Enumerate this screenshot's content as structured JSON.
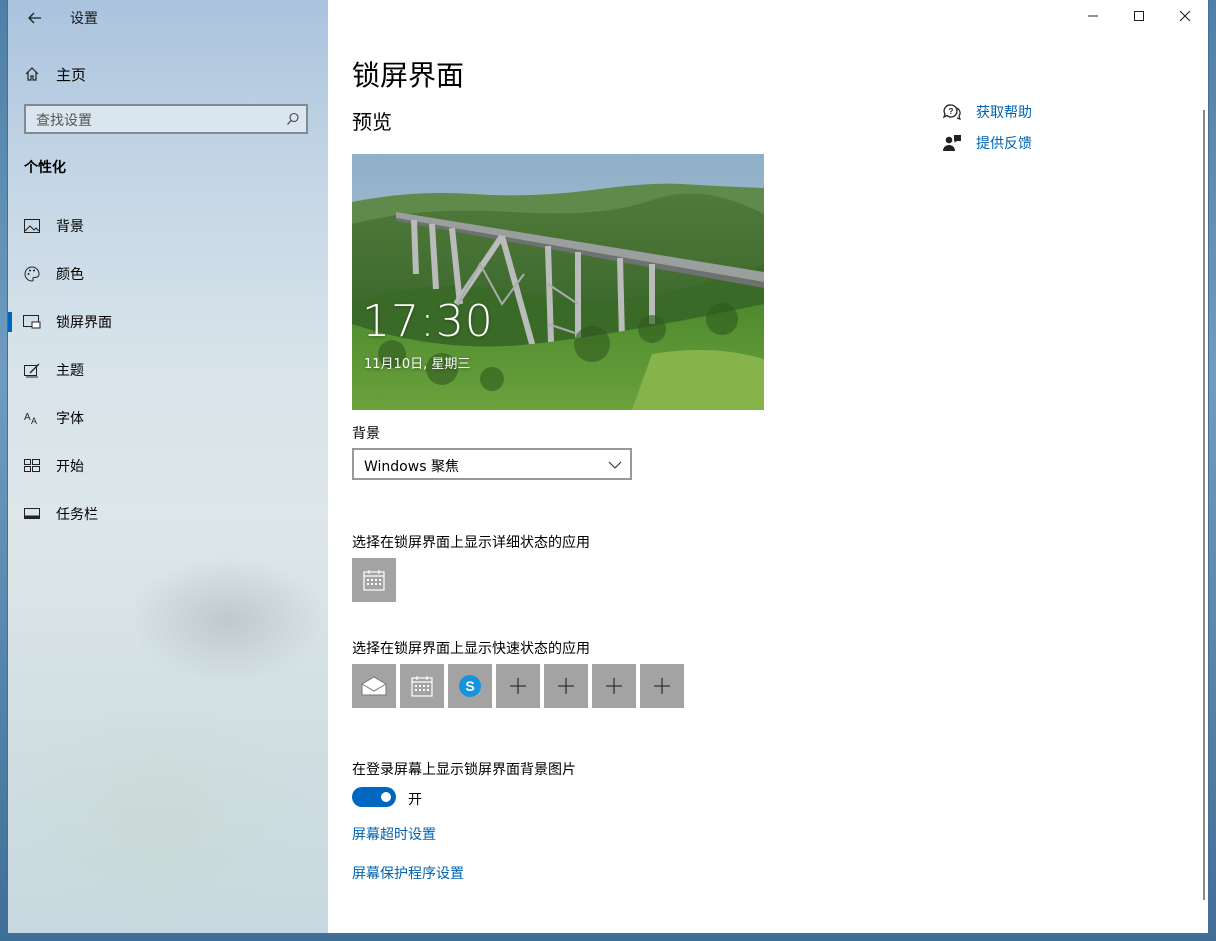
{
  "window": {
    "app_title": "设置",
    "controls": {
      "minimize": "minimize-icon",
      "maximize": "maximize-icon",
      "close": "close-icon"
    }
  },
  "sidebar": {
    "home_label": "主页",
    "search_placeholder": "查找设置",
    "section_title": "个性化",
    "items": [
      {
        "label": "背景",
        "icon": "picture-icon"
      },
      {
        "label": "颜色",
        "icon": "palette-icon"
      },
      {
        "label": "锁屏界面",
        "icon": "lock-screen-icon",
        "active": true
      },
      {
        "label": "主题",
        "icon": "theme-icon"
      },
      {
        "label": "字体",
        "icon": "font-icon"
      },
      {
        "label": "开始",
        "icon": "start-icon"
      },
      {
        "label": "任务栏",
        "icon": "taskbar-icon"
      }
    ]
  },
  "main": {
    "page_title": "锁屏界面",
    "preview_heading": "预览",
    "preview_time": "17:30",
    "preview_date": "11月10日, 星期三",
    "background_label": "背景",
    "background_value": "Windows 聚焦",
    "detailed_status_label": "选择在锁屏界面上显示详细状态的应用",
    "quick_status_label": "选择在锁屏界面上显示快速状态的应用",
    "quick_apps": [
      "mail-icon",
      "calendar-icon",
      "skype-icon",
      "plus-icon",
      "plus-icon",
      "plus-icon",
      "plus-icon"
    ],
    "signin_bg_label": "在登录屏幕上显示锁屏界面背景图片",
    "toggle_state": "开",
    "link_timeout": "屏幕超时设置",
    "link_screensaver": "屏幕保护程序设置",
    "help": {
      "get_help": "获取帮助",
      "feedback": "提供反馈"
    }
  },
  "colors": {
    "accent": "#0067c0",
    "link": "#0063b1",
    "tile": "#a3a3a3"
  }
}
